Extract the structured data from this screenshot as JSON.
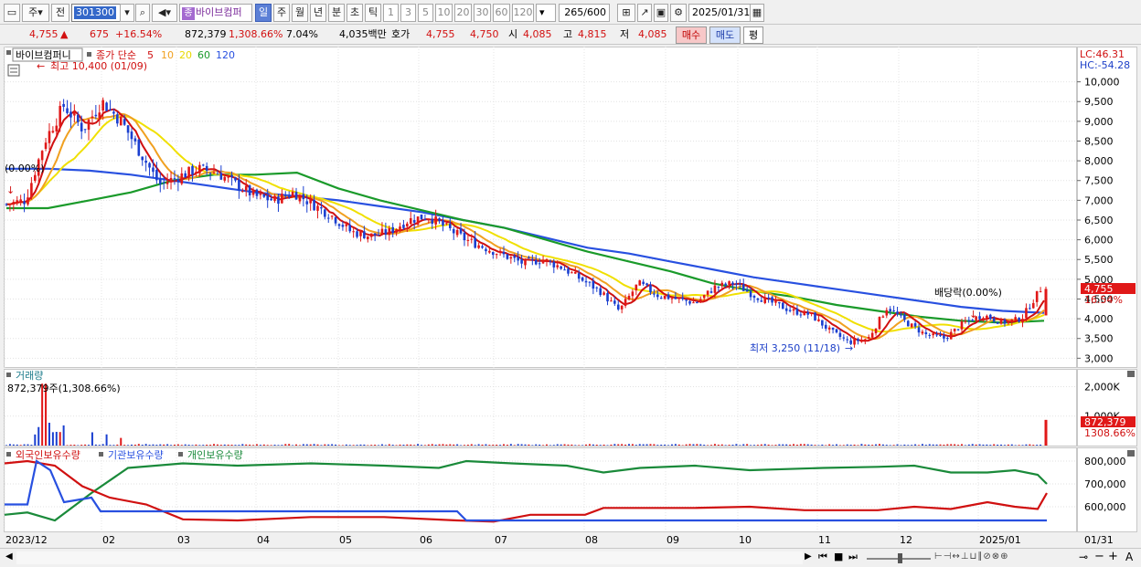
{
  "toolbar": {
    "period_main": "주",
    "prev_label": "전",
    "code": "301300",
    "stock_badge": "종",
    "stock_name": "바이브컴퍼",
    "periods": [
      "일",
      "주",
      "월",
      "년",
      "분",
      "초",
      "틱"
    ],
    "numbers": [
      "1",
      "3",
      "5",
      "10",
      "20",
      "30",
      "60",
      "120"
    ],
    "count": "265",
    "count_total": "/600",
    "date": "2025/01/31"
  },
  "quote": {
    "price": "4,755",
    "arrow": "▲",
    "change": "675",
    "change_pct": "+16.54%",
    "volume": "872,379",
    "volume_pct": "1,308.66%",
    "turnover": "7.04%",
    "amount": "4,035백만",
    "hoga_label": "호가",
    "ask": "4,755",
    "bid": "4,750",
    "open_label": "시",
    "open": "4,085",
    "high_label": "고",
    "high": "4,815",
    "low_label": "저",
    "low": "4,085",
    "buy_label": "매수",
    "sell_label": "매도",
    "eval_label": "평"
  },
  "price_panel": {
    "stock_label": "바이브컴퍼니",
    "ma_label": "종가 단순",
    "ma_periods": [
      "5",
      "10",
      "20",
      "60",
      "120"
    ],
    "ma_colors": [
      "#d01010",
      "#f0a020",
      "#f0e000",
      "#1a9a2a",
      "#2850e0"
    ],
    "high_note": "최고 10,400 (01/09)",
    "low_note": "최저 3,250 (11/18)",
    "ex_div_left": "(0.00%)",
    "ex_div_right": "배당락(0.00%)",
    "lc": "LC:46.31",
    "hc": "HC:-54.28",
    "y_ticks": [
      "10,000",
      "9,500",
      "9,000",
      "8,500",
      "8,000",
      "7,500",
      "7,000",
      "6,500",
      "6,000",
      "5,500",
      "5,000",
      "4,500",
      "4,000",
      "3,500",
      "3,000"
    ],
    "cur_price": "4,755",
    "cur_pct": "16.54%"
  },
  "volume_panel": {
    "title": "거래량",
    "value": "872,379주(1,308.66%)",
    "y_ticks": [
      "2,000K",
      "1,000K"
    ],
    "cur_volume": "872,379",
    "cur_pct": "1308.66%"
  },
  "holding_panel": {
    "series": [
      "외국인보유수량",
      "기관보유수량",
      "개인보유수량"
    ],
    "colors": [
      "#d01010",
      "#2850e0",
      "#1a8a3a"
    ],
    "y_ticks": [
      "800,000",
      "700,000",
      "600,000"
    ]
  },
  "x_axis": {
    "labels": [
      "2023/12",
      "02",
      "03",
      "04",
      "05",
      "06",
      "07",
      "08",
      "09",
      "10",
      "11",
      "12",
      "2025/01"
    ],
    "right_label": "01/31"
  },
  "chart_data": {
    "type": "candlestick",
    "x_range": [
      "2023/12",
      "2025/01/31"
    ],
    "price": {
      "ylim": [
        2800,
        10500
      ],
      "high": {
        "value": 10400,
        "date": "01/09"
      },
      "low": {
        "value": 3250,
        "date": "11/18"
      },
      "last": 4755,
      "approx_close_path": [
        6900,
        7000,
        8500,
        9400,
        8800,
        9500,
        9000,
        8200,
        7400,
        7600,
        7800,
        7700,
        7400,
        7100,
        7000,
        7200,
        6900,
        6600,
        6200,
        6100,
        6200,
        6500,
        6600,
        6300,
        6000,
        5800,
        5600,
        5400,
        5500,
        5300,
        5000,
        4700,
        4200,
        4900,
        4600,
        4500,
        4400,
        4800,
        4900,
        4600,
        4400,
        4200,
        4100,
        3700,
        3400,
        3500,
        4300,
        3900,
        3600,
        3500,
        3900,
        4100,
        3900,
        4000,
        4755
      ]
    },
    "ma": {
      "120": [
        7800,
        7800,
        7750,
        7650,
        7500,
        7350,
        7200,
        7100,
        7000,
        6850,
        6700,
        6500,
        6300,
        6050,
        5800,
        5650,
        5450,
        5250,
        5050,
        4900,
        4750,
        4600,
        4450,
        4300,
        4200,
        4150
      ],
      "60": [
        6800,
        6800,
        7000,
        7200,
        7500,
        7650,
        7650,
        7700,
        7300,
        7000,
        6750,
        6500,
        6300,
        6000,
        5700,
        5450,
        5200,
        4900,
        4700,
        4550,
        4350,
        4200,
        4050,
        3950,
        3900,
        3950
      ]
    },
    "volume": {
      "last": 872379,
      "last_pct": 1308.66,
      "ylim": [
        0,
        2200000
      ]
    },
    "holdings": {
      "series_names": [
        "외국인보유수량",
        "기관보유수량",
        "개인보유수량"
      ],
      "ylim": [
        500000,
        820000
      ]
    }
  }
}
